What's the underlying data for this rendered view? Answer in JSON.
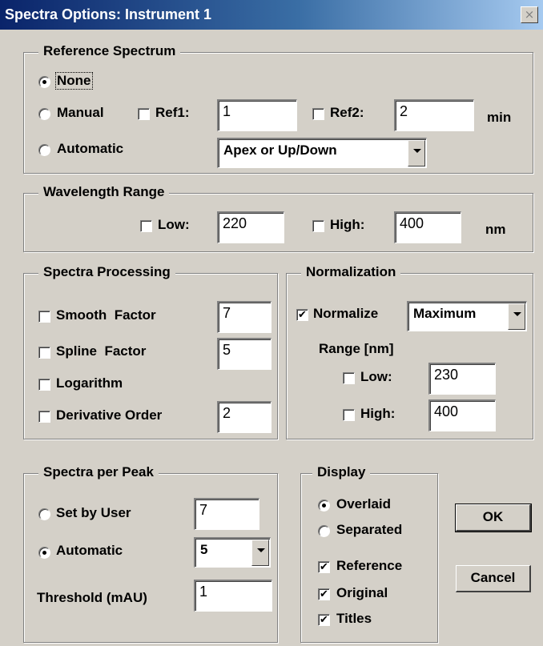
{
  "window": {
    "title": "Spectra Options: Instrument 1",
    "close_glyph": "×"
  },
  "reference_spectrum": {
    "legend": "Reference Spectrum",
    "none_label": "None",
    "manual_label": "Manual",
    "automatic_label": "Automatic",
    "ref1_label": "Ref1:",
    "ref1_value": "1",
    "ref2_label": "Ref2:",
    "ref2_value": "2",
    "unit": "min",
    "auto_mode": "Apex or Up/Down"
  },
  "wavelength_range": {
    "legend": "Wavelength Range",
    "low_label": "Low:",
    "low_value": "220",
    "high_label": "High:",
    "high_value": "400",
    "unit": "nm"
  },
  "spectra_processing": {
    "legend": "Spectra Processing",
    "smooth_label": "Smooth  Factor",
    "smooth_value": "7",
    "spline_label": "Spline  Factor",
    "spline_value": "5",
    "logarithm_label": "Logarithm",
    "derivative_label": "Derivative Order",
    "derivative_value": "2"
  },
  "normalization": {
    "legend": "Normalization",
    "normalize_label": "Normalize",
    "normalize_mode": "Maximum",
    "range_label": "Range [nm]",
    "low_label": "Low:",
    "low_value": "230",
    "high_label": "High:",
    "high_value": "400"
  },
  "spectra_per_peak": {
    "legend": "Spectra per Peak",
    "set_by_user_label": "Set by User",
    "set_by_user_value": "7",
    "automatic_label": "Automatic",
    "automatic_value": "5",
    "threshold_label": "Threshold (mAU)",
    "threshold_value": "1"
  },
  "display": {
    "legend": "Display",
    "overlaid_label": "Overlaid",
    "separated_label": "Separated",
    "reference_label": "Reference",
    "original_label": "Original",
    "titles_label": "Titles"
  },
  "buttons": {
    "ok": "OK",
    "cancel": "Cancel"
  },
  "checkmark": "✔"
}
